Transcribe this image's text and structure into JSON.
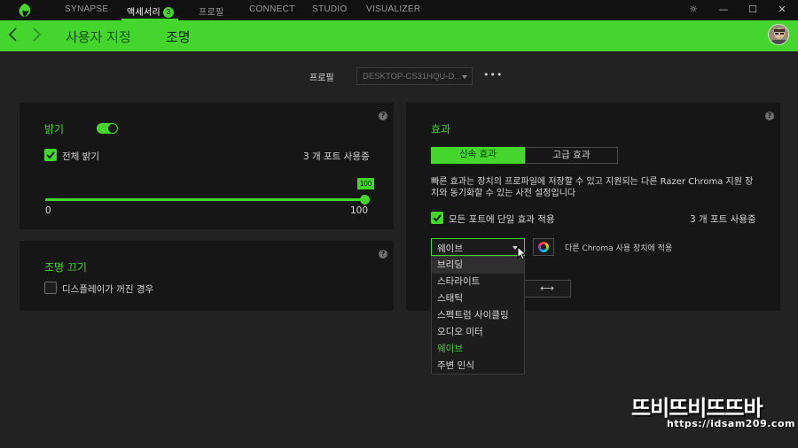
{
  "topbar": {
    "tabs": [
      {
        "label": "SYNAPSE"
      },
      {
        "label": "액세서리",
        "badge": "3"
      },
      {
        "label": "프로필"
      },
      {
        "label": "CONNECT"
      },
      {
        "label": "STUDIO"
      },
      {
        "label": "VISUALIZER"
      }
    ],
    "active_tab": "액세서리",
    "window_buttons": {
      "settings": "☼",
      "minimize": "—",
      "maximize": "☐",
      "close": "✕"
    }
  },
  "header": {
    "breadcrumbs": [
      "사용자 지정",
      "조명"
    ],
    "current": "조명"
  },
  "profile": {
    "label": "프로필",
    "value": "DESKTOP-CS31HQU-D...",
    "more": "•••"
  },
  "brightness_panel": {
    "title": "밝기",
    "toggle_on": true,
    "checkbox_label": "전체 밝기",
    "checkbox_checked": true,
    "ports_text": "3 개 포트 사용중",
    "slider": {
      "value": 100,
      "min_label": "0",
      "max_label": "100",
      "tooltip": "100"
    },
    "help": "?"
  },
  "lights_off_panel": {
    "title": "조명 끄기",
    "checkbox_label": "디스플레이가 꺼진 경우",
    "checkbox_checked": false,
    "help": "?"
  },
  "effects_panel": {
    "title": "효과",
    "tabs": [
      "신속 효과",
      "고급 효과"
    ],
    "active_tab": "신속 효과",
    "description": "빠른 효과는 장치의 프로파일에 저장할 수 있고 지원되는 다른 Razer Chroma 지원 장치와 동기화할 수 있는 사전 설정입니다",
    "apply_all_label": "모든 포트에 단일 효과 적용",
    "apply_all_checked": true,
    "ports_text": "3 개 포트 사용중",
    "effect_select": "웨이브",
    "sync_hint": "다른 Chroma 사용 장치에 적용",
    "direction_icon": "⟷",
    "help": "?"
  },
  "effect_dropdown": {
    "options": [
      "브리딩",
      "스타라이트",
      "스태틱",
      "스펙트럼 사이클링",
      "오디오 미터",
      "웨이브",
      "주변 인식"
    ],
    "hovered": "브리딩",
    "selected": "웨이브"
  },
  "watermark": {
    "logo_text": "뜨비뜨비뜨뜨바",
    "url": "https://idsam209.com"
  },
  "colors": {
    "accent": "#44d62c",
    "background": "#222222",
    "panel": "#161616",
    "titlebar": "#111111"
  }
}
